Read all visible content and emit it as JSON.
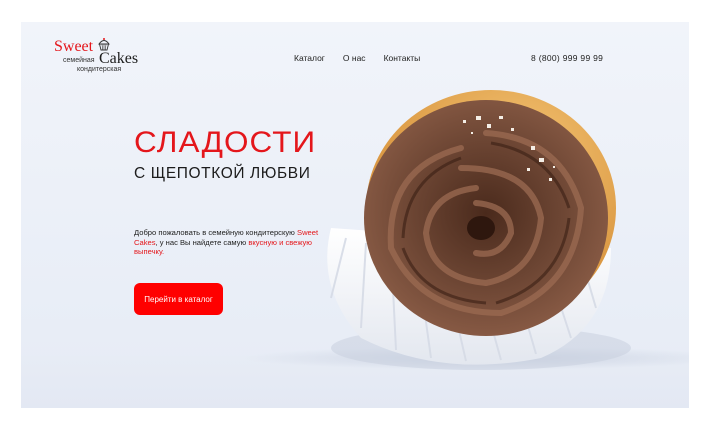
{
  "logo": {
    "word1": "Sweet",
    "word2": "Cakes",
    "line1": "семейная",
    "line2": "кондитерская"
  },
  "nav": {
    "items": [
      {
        "label": "Каталог"
      },
      {
        "label": "О нас"
      },
      {
        "label": "Контакты"
      }
    ]
  },
  "phone": "8 (800) 999 99 99",
  "hero": {
    "title": "СЛАДОСТИ",
    "subtitle": "С ЩЕПОТКОЙ ЛЮБВИ",
    "desc_part1": "Добро пожаловать в семейную кондитерскую ",
    "desc_brand": "Sweet Cakes",
    "desc_part2": ", у нас Вы найдете самую ",
    "desc_highlight": "вкусную и свежую выпечку.",
    "cta": "Перейти в каталог"
  },
  "colors": {
    "accent": "#e4161b",
    "button": "#ff0000",
    "frosting": "#6b4431",
    "background": "#eef2f9"
  },
  "icons": {
    "logo_icon": "cupcake-icon"
  }
}
